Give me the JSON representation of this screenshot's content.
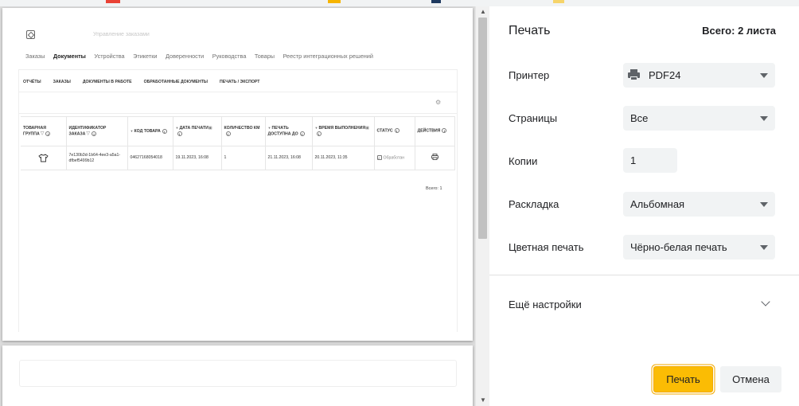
{
  "preview": {
    "app_title": "Управление заказами",
    "main_nav": [
      "Заказы",
      "Документы",
      "Устройства",
      "Этикетки",
      "Доверенности",
      "Руководства",
      "Товары",
      "Реестр интеграционных решений"
    ],
    "sub_tabs": [
      "ОТЧЁТЫ",
      "ЗАКАЗЫ",
      "ДОКУМЕНТЫ В РАБОТЕ",
      "ОБРАБОТАННЫЕ ДОКУМЕНТЫ",
      "ПЕЧАТЬ / ЭКСПОРТ"
    ],
    "table": {
      "headers": {
        "group": "ТОВАРНАЯ ГРУППА",
        "order_id": "ИДЕНТИФИКАТОР ЗАКАЗА",
        "code": "КОД ТОВАРА",
        "print_date": "ДАТА ПЕЧАТИ",
        "km_count": "КОЛИЧЕСТВО КМ",
        "print_until": "ПЕЧАТЬ ДОСТУПНА ДО",
        "exec_time": "ВРЕМЯ ВЫПОЛНЕНИЯ",
        "status": "СТАТУС",
        "actions": "ДЕЙСТВИЯ"
      },
      "row": {
        "group_icon": "tshirt-icon",
        "order_id": "7e130b3d-1b64-4ee3-a5a1-dfbef5499b12",
        "code": "04627168054018",
        "print_date": "19.11.2023, 16:08",
        "km_count": "1",
        "print_until": "21.11.2023, 16:08",
        "exec_time": "20.11.2023, 11:35",
        "status": "Обработан",
        "action_icon": "printer-icon"
      }
    },
    "total": "Всего: 1"
  },
  "panel": {
    "title": "Печать",
    "sheet_count": "Всего: 2 листа",
    "printer_label": "Принтер",
    "printer_value": "PDF24",
    "pages_label": "Страницы",
    "pages_value": "Все",
    "copies_label": "Копии",
    "copies_value": "1",
    "layout_label": "Раскладка",
    "layout_value": "Альбомная",
    "color_label": "Цветная печать",
    "color_value": "Чёрно-белая печать",
    "more_settings": "Ещё настройки",
    "print_button": "Печать",
    "cancel_button": "Отмена"
  },
  "colors": {
    "print_button": "#fbbc04",
    "select_bg": "#f1f3f4",
    "preview_bg": "#dcdcdc"
  }
}
